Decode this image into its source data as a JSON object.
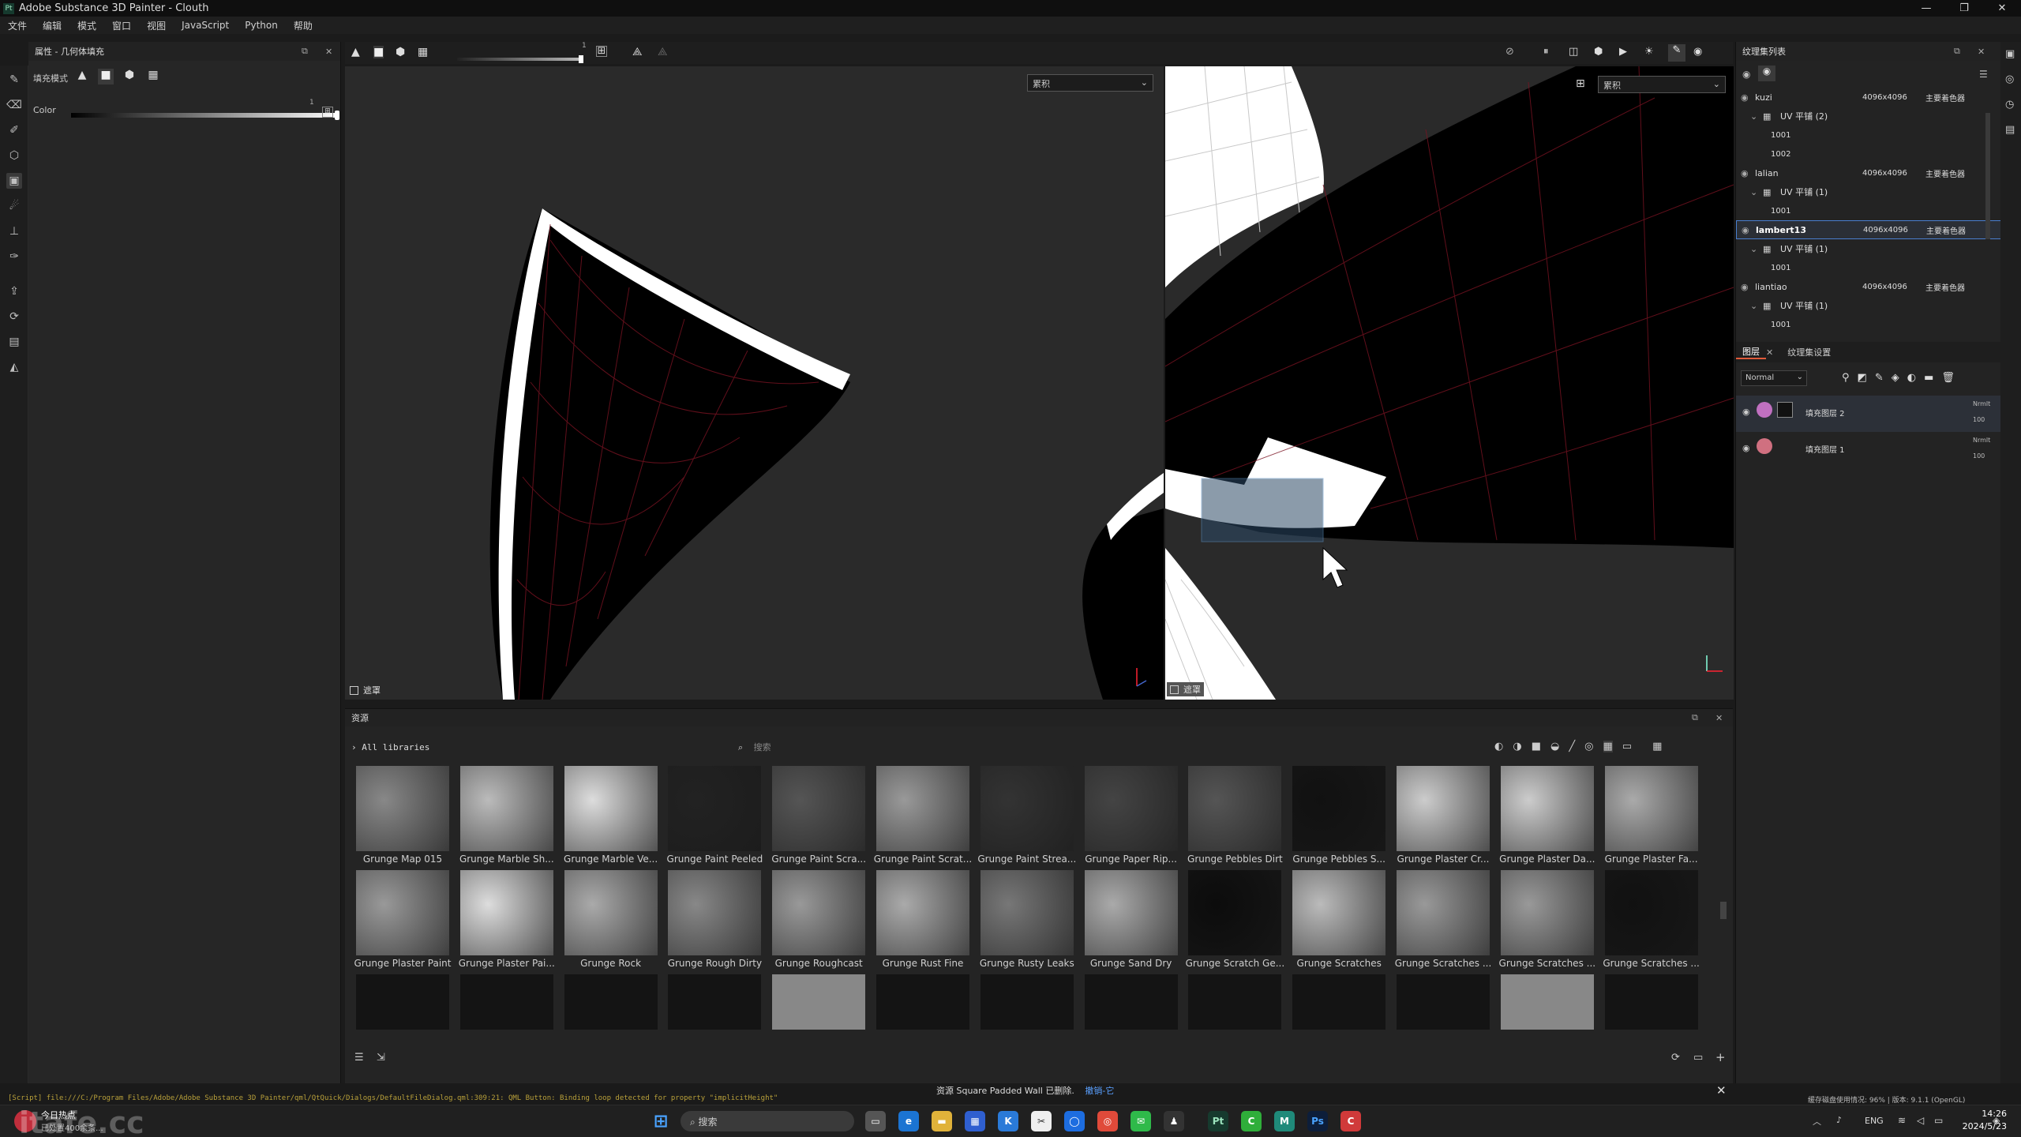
{
  "window": {
    "app_icon": "Pt",
    "title": "Adobe Substance 3D Painter - Clouth",
    "controls": {
      "minimize": "—",
      "maximize": "❐",
      "close": "✕"
    }
  },
  "menubar": [
    "文件",
    "编辑",
    "模式",
    "窗口",
    "视图",
    "JavaScript",
    "Python",
    "帮助"
  ],
  "properties_panel": {
    "title": "属性 - 几何体填充",
    "fill_mode_label": "填充模式",
    "color_label": "Color",
    "slider_max_label": "1",
    "color_slider_value": 1.0
  },
  "viewport_toolbar": {
    "slider_value_label": "1",
    "brush_size_value": 1.0
  },
  "viewport_left": {
    "channel_select": "累积",
    "mask_label": "遮罩"
  },
  "viewport_right": {
    "channel_select": "累积",
    "mask_label": "遮罩"
  },
  "texture_set_list": {
    "title": "纹理集列表",
    "rows": [
      {
        "type": "set",
        "name": "kuzi",
        "size": "4096x4096",
        "shader": "主要着色器",
        "selected": false
      },
      {
        "type": "uv",
        "name": "UV 平铺 (2)"
      },
      {
        "type": "tile",
        "name": "1001"
      },
      {
        "type": "tile",
        "name": "1002"
      },
      {
        "type": "set",
        "name": "lalian",
        "size": "4096x4096",
        "shader": "主要着色器",
        "selected": false
      },
      {
        "type": "uv",
        "name": "UV 平铺 (1)"
      },
      {
        "type": "tile",
        "name": "1001"
      },
      {
        "type": "set",
        "name": "lambert13",
        "size": "4096x4096",
        "shader": "主要着色器",
        "selected": true
      },
      {
        "type": "uv",
        "name": "UV 平铺 (1)"
      },
      {
        "type": "tile",
        "name": "1001"
      },
      {
        "type": "set",
        "name": "liantiao",
        "size": "4096x4096",
        "shader": "主要着色器",
        "selected": false
      },
      {
        "type": "uv",
        "name": "UV 平铺 (1)"
      },
      {
        "type": "tile",
        "name": "1001"
      }
    ]
  },
  "layers_panel": {
    "tab_layers": "图层",
    "tab_settings": "纹理集设置",
    "blend_mode": "Normal",
    "layers": [
      {
        "name": "填充图层 2",
        "blend": "Nrmlt",
        "opacity": "100",
        "selected": true,
        "thumb_color": "#c070c0"
      },
      {
        "name": "填充图层 1",
        "blend": "Nrmlt",
        "opacity": "100",
        "selected": false,
        "thumb_color": "#d07080"
      }
    ]
  },
  "assets_panel": {
    "title": "资源",
    "breadcrumb": "All libraries",
    "search_placeholder": "搜索",
    "row1": [
      "Grunge Map 015",
      "Grunge Marble Sh...",
      "Grunge Marble Ve...",
      "Grunge Paint Peeled",
      "Grunge Paint Scra...",
      "Grunge Paint Scrat...",
      "Grunge Paint Strea...",
      "Grunge Paper Rip...",
      "Grunge Pebbles Dirt",
      "Grunge Pebbles S...",
      "Grunge Plaster Cr...",
      "Grunge Plaster Da...",
      "Grunge Plaster Fa..."
    ],
    "row2": [
      "Grunge Plaster Paint",
      "Grunge Plaster Pai...",
      "Grunge Rock",
      "Grunge Rough Dirty",
      "Grunge Roughcast",
      "Grunge Rust Fine",
      "Grunge Rusty Leaks",
      "Grunge Sand Dry",
      "Grunge Scratch Ge...",
      "Grunge Scratches",
      "Grunge Scratches ...",
      "Grunge Scratches ...",
      "Grunge Scratches ..."
    ],
    "status_text": "资源 Square Padded Wall 已删除.",
    "status_link": "撤销-它"
  },
  "statusbar": {
    "log": "[Script] file:///C:/Program Files/Adobe/Adobe Substance 3D Painter/qml/QtQuick/Dialogs/DefaultFileDialog.qml:309:21: QML Button: Binding loop detected for property \"implicitHeight\"",
    "right": "缓存磁盘使用情况: 96% | 版本: 9.1.1 (OpenGL)"
  },
  "taskbar": {
    "news_title": "今日热点",
    "news_sub": "已处置400余条...",
    "search_placeholder": "搜索",
    "lang": "ENG",
    "time": "14:26",
    "date": "2024/5/23"
  },
  "watermark": "itafe.cc"
}
